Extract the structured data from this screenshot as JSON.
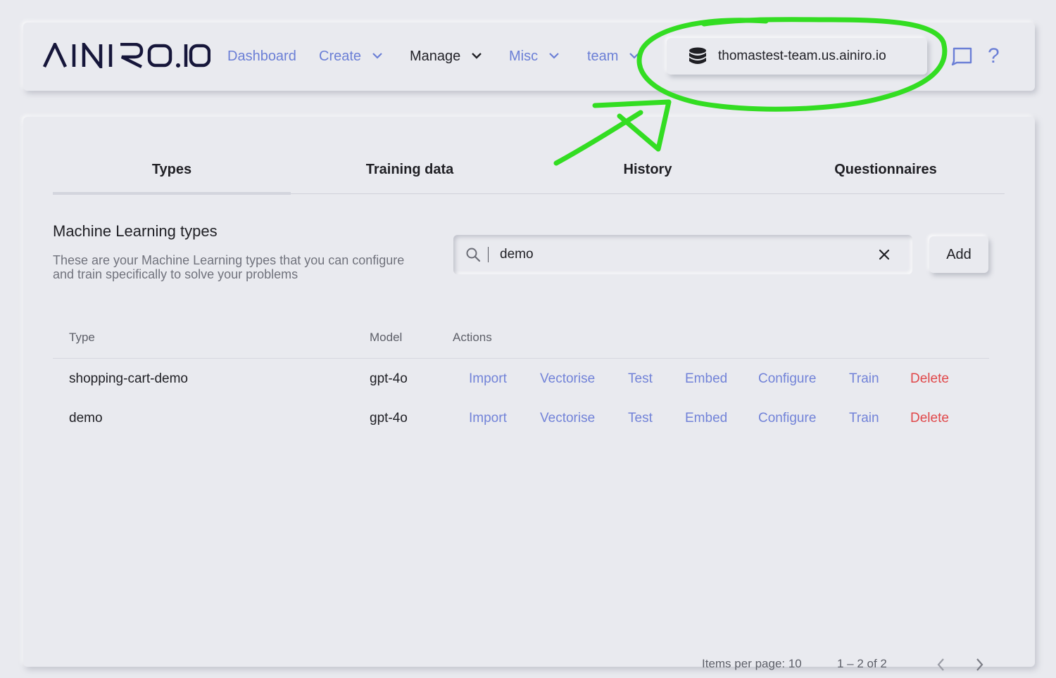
{
  "brand": {
    "logo_text": "AINIRO.IO",
    "accent": "#6b7fd6",
    "danger": "#e0484a"
  },
  "navbar": {
    "dashboard": "Dashboard",
    "create": "Create",
    "manage": "Manage",
    "misc": "Misc",
    "team": "team",
    "domain": "thomastest-team.us.ainiro.io",
    "help": "?"
  },
  "tabs": [
    {
      "label": "Types",
      "active": true
    },
    {
      "label": "Training data",
      "active": false
    },
    {
      "label": "History",
      "active": false
    },
    {
      "label": "Questionnaires",
      "active": false
    }
  ],
  "section": {
    "title": "Machine Learning types",
    "description": "These are your Machine Learning types that you can configure and train specifically to solve your problems"
  },
  "search": {
    "value": "demo",
    "placeholder": ""
  },
  "add_label": "Add",
  "table": {
    "headers": {
      "type": "Type",
      "model": "Model",
      "actions": "Actions"
    },
    "rows": [
      {
        "type": "shopping-cart-demo",
        "model": "gpt-4o",
        "actions": [
          "Import",
          "Vectorise",
          "Test",
          "Embed",
          "Configure",
          "Train",
          "Delete"
        ]
      },
      {
        "type": "demo",
        "model": "gpt-4o",
        "actions": [
          "Import",
          "Vectorise",
          "Test",
          "Embed",
          "Configure",
          "Train",
          "Delete"
        ]
      }
    ]
  },
  "pagination": {
    "items_per_page": "Items per page: 10",
    "range": "1 – 2 of 2"
  },
  "annotation": {
    "color": "#33dd22"
  }
}
